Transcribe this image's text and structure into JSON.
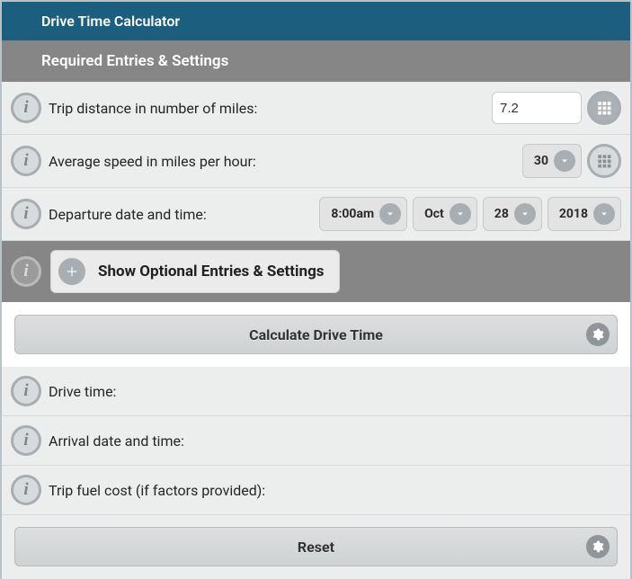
{
  "title": "Drive Time Calculator",
  "section_required": "Required Entries & Settings",
  "rows": {
    "distance": {
      "label": "Trip distance in number of miles:",
      "value": "7.2"
    },
    "speed": {
      "label": "Average speed in miles per hour:",
      "value": "30"
    },
    "departure": {
      "label": "Departure date and time:",
      "time": "8:00am",
      "month": "Oct",
      "day": "28",
      "year": "2018"
    }
  },
  "optional_toggle": "Show Optional Entries & Settings",
  "calc_button": "Calculate Drive Time",
  "results": {
    "drive_time": {
      "label": "Drive time:",
      "value": ""
    },
    "arrival": {
      "label": "Arrival date and time:",
      "value": ""
    },
    "fuel": {
      "label": "Trip fuel cost (if factors provided):",
      "value": ""
    }
  },
  "reset_button": "Reset"
}
